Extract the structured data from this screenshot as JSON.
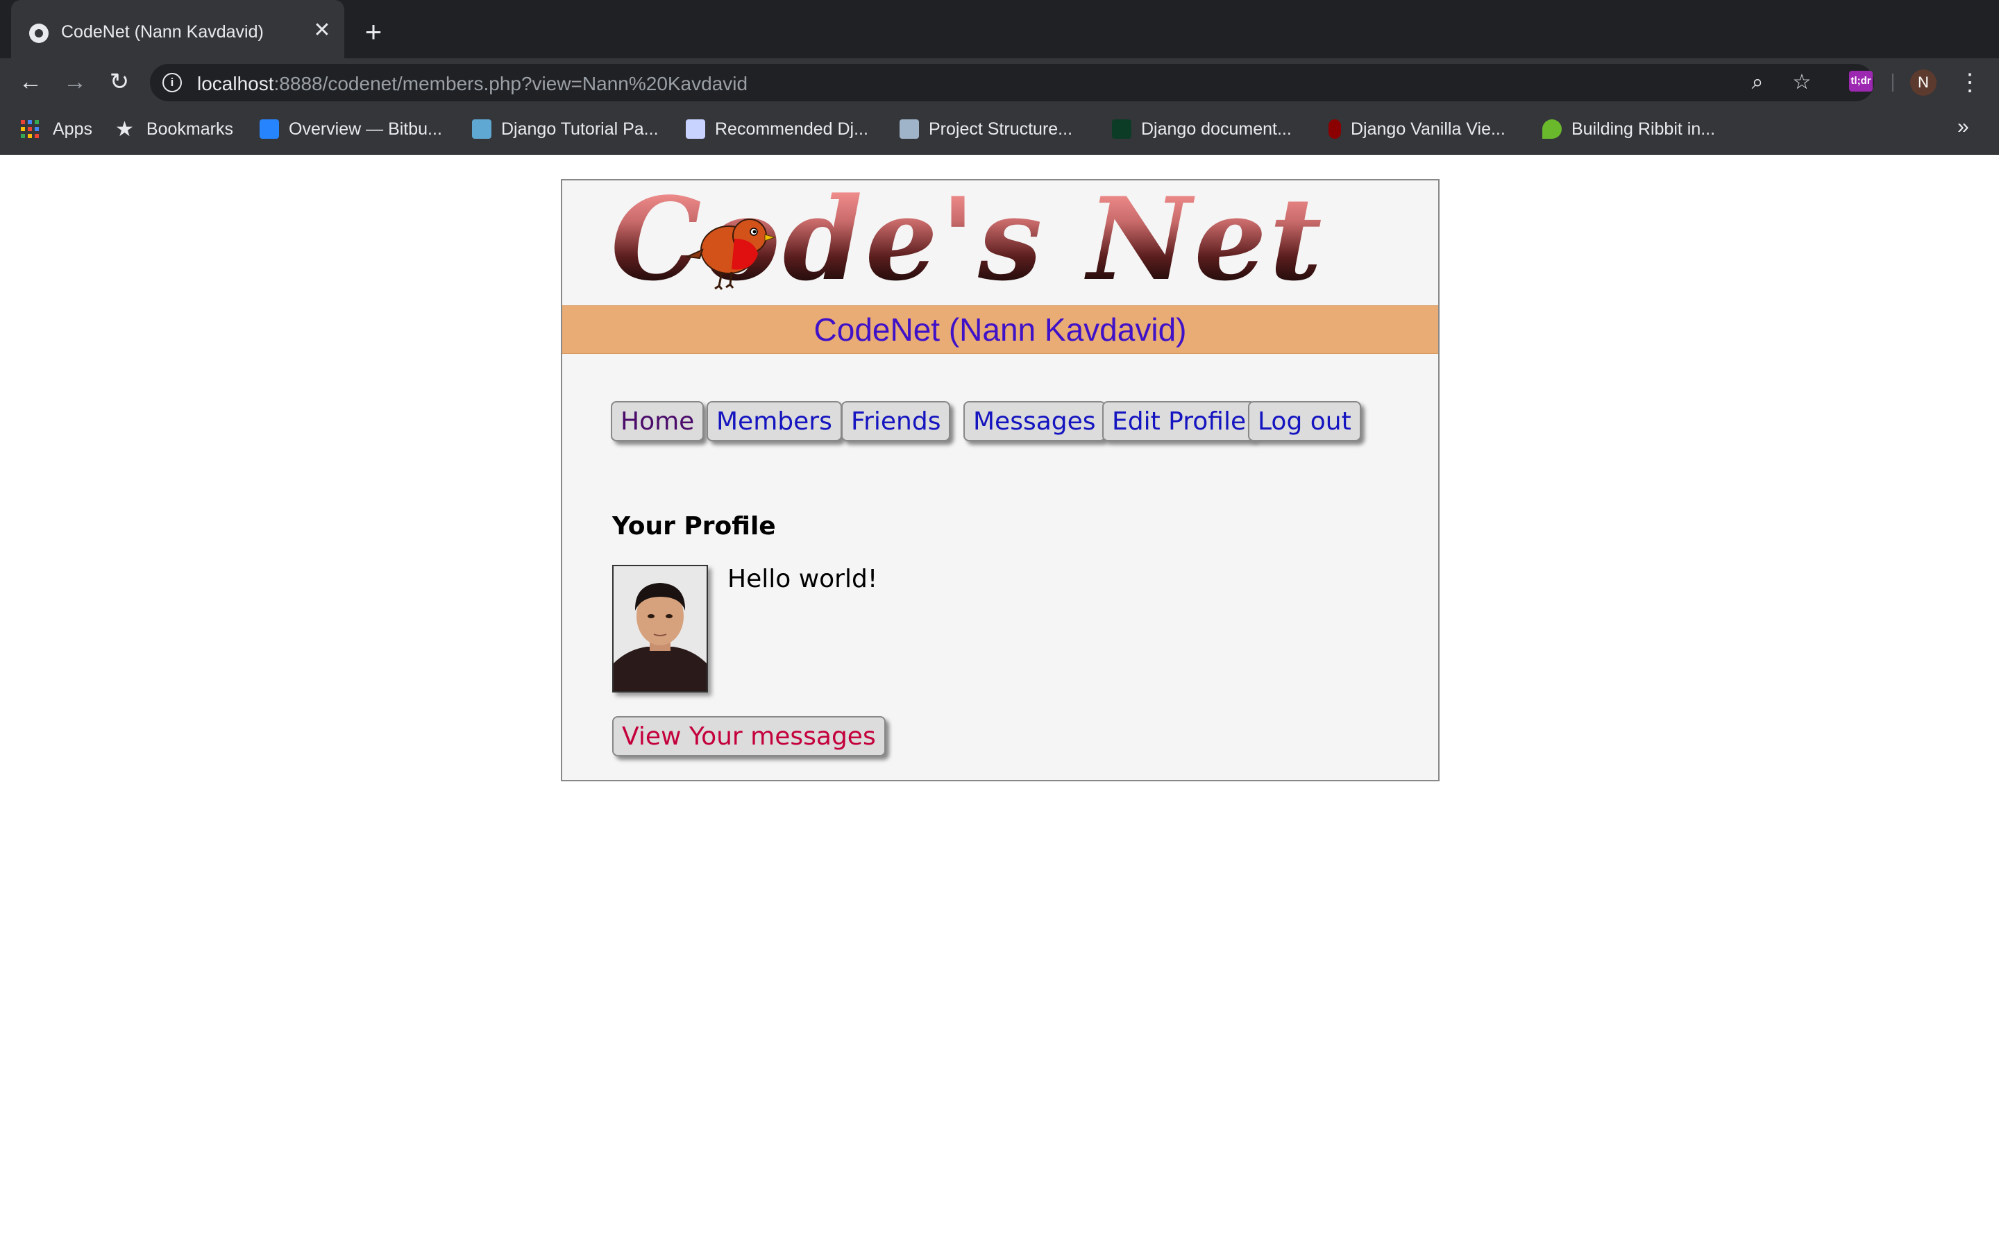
{
  "browser": {
    "tab_title": "CodeNet (Nann Kavdavid)",
    "url_host": "localhost",
    "url_rest": ":8888/codenet/members.php?view=Nann%20Kavdavid",
    "extension_label": "tl;dr",
    "profile_initial": "N",
    "bookmarks": [
      {
        "label": "Apps",
        "icon": "apps-grid-icon"
      },
      {
        "label": "Bookmarks",
        "icon": "star-icon"
      },
      {
        "label": "Overview — Bitbu...",
        "icon": "bitbucket-icon",
        "color": "#2684ff"
      },
      {
        "label": "Django Tutorial Pa...",
        "icon": "django-tutorial-icon",
        "color": "#5fa8d3"
      },
      {
        "label": "Recommended Dj...",
        "icon": "devsts-icon",
        "color": "#c9d3ff"
      },
      {
        "label": "Project Structure...",
        "icon": "project-structure-icon",
        "color": "#9fb4c8"
      },
      {
        "label": "Django document...",
        "icon": "dj-icon",
        "color": "#0c3c26"
      },
      {
        "label": "Django Vanilla Vie...",
        "icon": "vanilla-icon",
        "color": "#8b0000"
      },
      {
        "label": "Building Ribbit in...",
        "icon": "ribbit-icon",
        "color": "#6ab82c"
      }
    ]
  },
  "site": {
    "logo_text": "Code's Net",
    "banner": "CodeNet (Nann Kavdavid)",
    "menu": [
      "Home",
      "Members",
      "Friends",
      "Messages",
      "Edit Profile",
      "Log out"
    ],
    "profile_heading": "Your Profile",
    "profile_text": "Hello world!",
    "view_messages": "View Your messages"
  },
  "colors": {
    "banner_bg": "#e8ac74",
    "banner_text": "#3f11c8",
    "menu_link": "#1414c0",
    "menu_visited": "#4a0b6a",
    "view_messages": "#c4003c"
  }
}
